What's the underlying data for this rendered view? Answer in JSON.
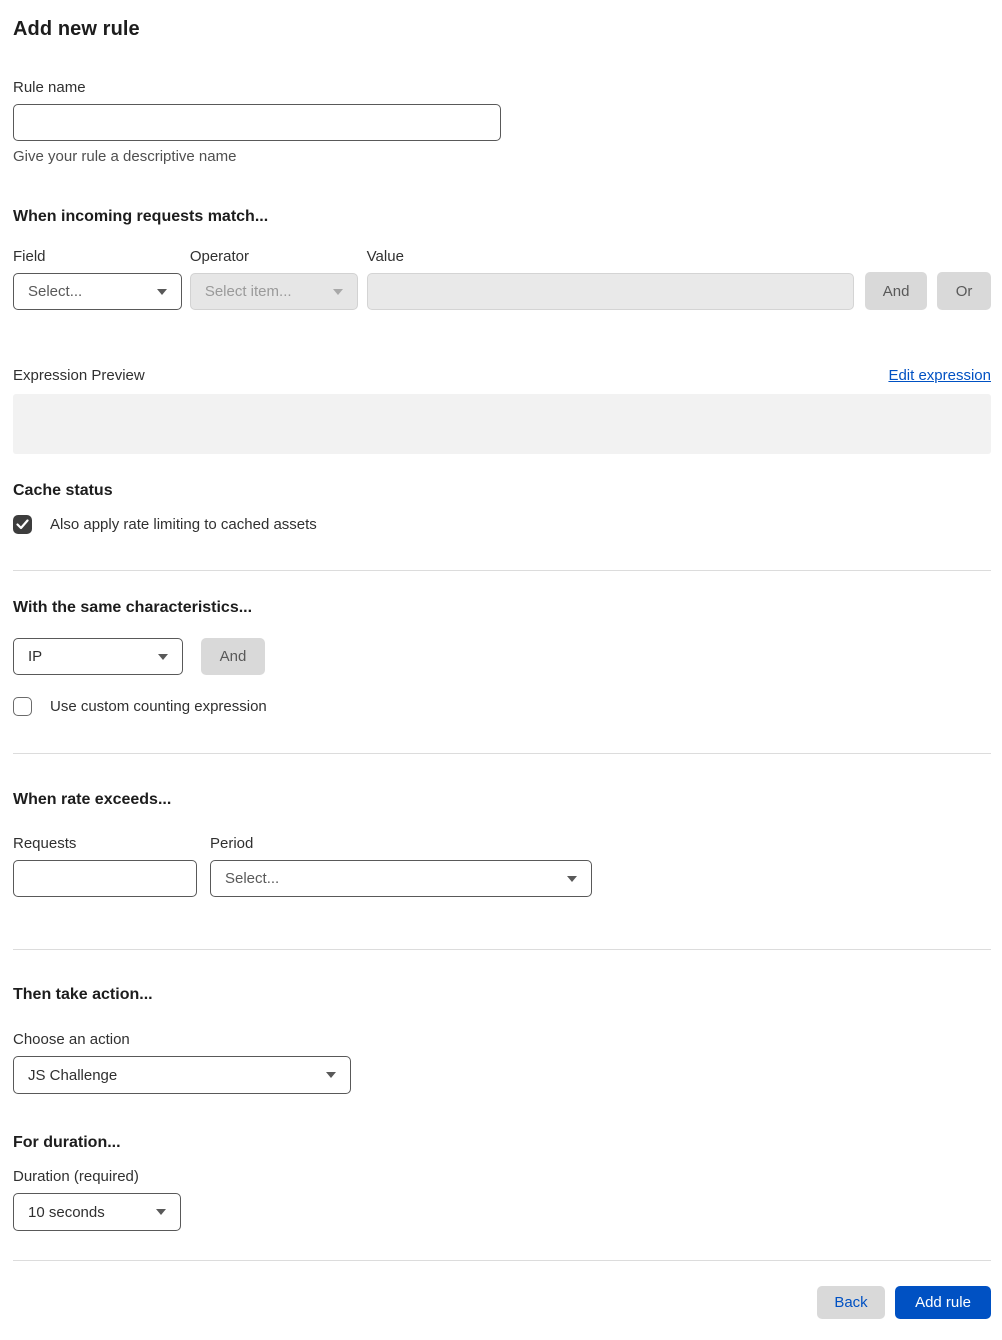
{
  "page": {
    "title": "Add new rule"
  },
  "rule_name": {
    "label": "Rule name",
    "value": "",
    "help": "Give your rule a descriptive name"
  },
  "match": {
    "heading": "When incoming requests match...",
    "field_label": "Field",
    "field_value": "Select...",
    "operator_label": "Operator",
    "operator_value": "Select item...",
    "value_label": "Value",
    "value_value": "",
    "and_label": "And",
    "or_label": "Or",
    "expression_preview_label": "Expression Preview",
    "edit_expression_label": "Edit expression",
    "expression_value": ""
  },
  "cache_status": {
    "heading": "Cache status",
    "checkbox_label": "Also apply rate limiting to cached assets",
    "checked": true
  },
  "characteristics": {
    "heading": "With the same characteristics...",
    "select_value": "IP",
    "and_label": "And",
    "checkbox_label": "Use custom counting expression",
    "checked": false
  },
  "rate": {
    "heading": "When rate exceeds...",
    "requests_label": "Requests",
    "requests_value": "",
    "period_label": "Period",
    "period_value": "Select..."
  },
  "action": {
    "heading": "Then take action...",
    "label": "Choose an action",
    "value": "JS Challenge"
  },
  "duration": {
    "heading": "For duration...",
    "label": "Duration (required)",
    "value": "10 seconds"
  },
  "footer": {
    "back_label": "Back",
    "submit_label": "Add rule"
  },
  "colors": {
    "accent_blue": "#0051c3",
    "button_gray": "#d9d9d9",
    "checkbox_dark": "#3d3d3d",
    "preview_gray": "#f2f2f2"
  }
}
